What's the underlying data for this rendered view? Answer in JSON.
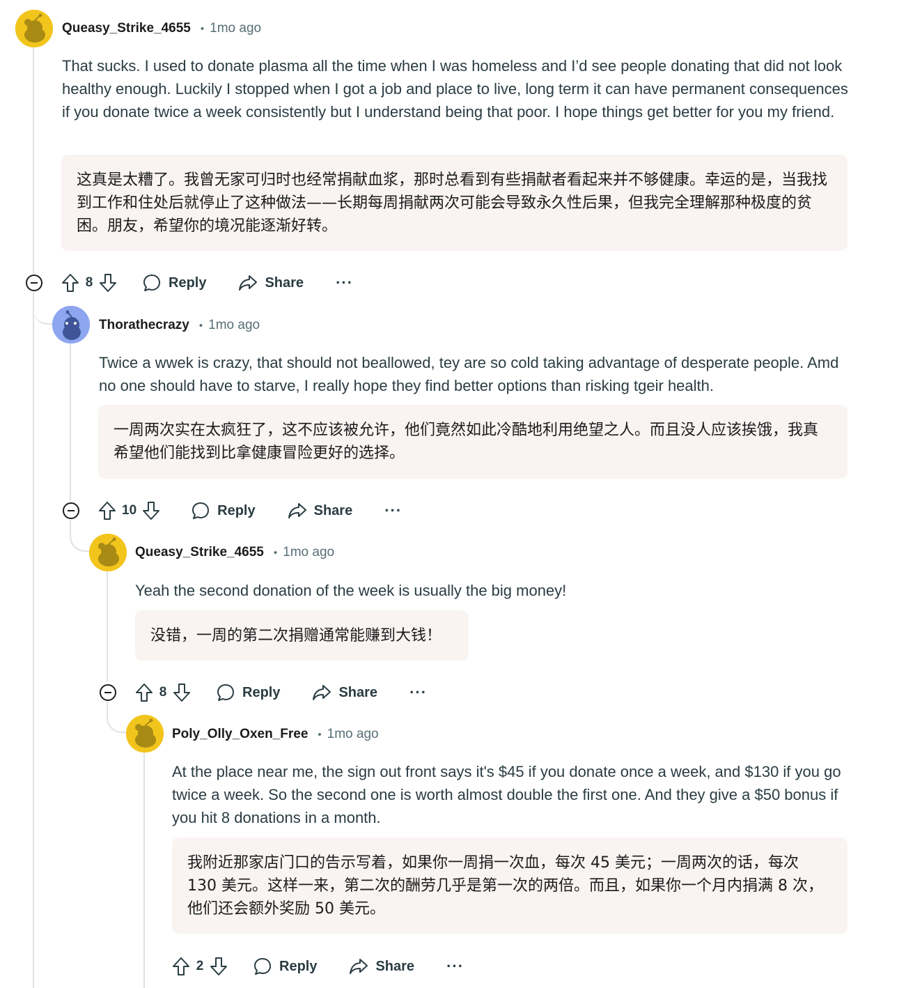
{
  "comments": [
    {
      "author": "Queasy_Strike_4655",
      "separator": "•",
      "time": "1mo ago",
      "body": "That sucks. I used to donate plasma all the time when I was homeless and I’d see people donating that did not look healthy enough. Luckily I stopped when I got a job and place to live, long term it can have permanent consequences if you donate twice a week consistently but I understand being that poor. I hope things get better for you my friend.",
      "translation": "这真是太糟了。我曾无家可归时也经常捐献血浆，那时总看到有些捐献者看起来并不够健康。幸运的是，当我找到工作和住处后就停止了这种做法——长期每周捐献两次可能会导致永久性后果，但我完全理解那种极度的贫困。朋友，希望你的境况能逐渐好转。",
      "votes": "8",
      "reply_label": "Reply",
      "share_label": "Share",
      "more_label": "···",
      "avatar_color": "#f2c51d"
    },
    {
      "author": "Thorathecrazy",
      "separator": "•",
      "time": "1mo ago",
      "body": "Twice a wwek is crazy, that should not beallowed, tey are so cold taking advantage of desperate people. Amd no one should have to starve, I really hope they find better options than risking tgeir health.",
      "translation": "一周两次实在太疯狂了，这不应该被允许，他们竟然如此冷酷地利用绝望之人。而且没人应该挨饿，我真希望他们能找到比拿健康冒险更好的选择。",
      "votes": "10",
      "reply_label": "Reply",
      "share_label": "Share",
      "more_label": "···",
      "avatar_color": "#8ea6f0"
    },
    {
      "author": "Queasy_Strike_4655",
      "separator": "•",
      "time": "1mo ago",
      "body": "Yeah the second donation of the week is usually the big money!",
      "translation": "没错，一周的第二次捐赠通常能赚到大钱！",
      "votes": "8",
      "reply_label": "Reply",
      "share_label": "Share",
      "more_label": "···",
      "avatar_color": "#f2c51d"
    },
    {
      "author": "Poly_Olly_Oxen_Free",
      "separator": "•",
      "time": "1mo ago",
      "body": "At the place near me, the sign out front says it's $45 if you donate once a week, and $130 if you go twice a week. So the second one is worth almost double the first one. And they give a $50 bonus if you hit 8 donations in a month.",
      "translation": "我附近那家店门口的告示写着，如果你一周捐一次血，每次 45 美元；一周两次的话，每次 130 美元。这样一来，第二次的酬劳几乎是第一次的两倍。而且，如果你一个月内捐满 8 次，他们还会额外奖励 50 美元。",
      "votes": "2",
      "reply_label": "Reply",
      "share_label": "Share",
      "more_label": "···",
      "avatar_color": "#f2c51d"
    }
  ]
}
